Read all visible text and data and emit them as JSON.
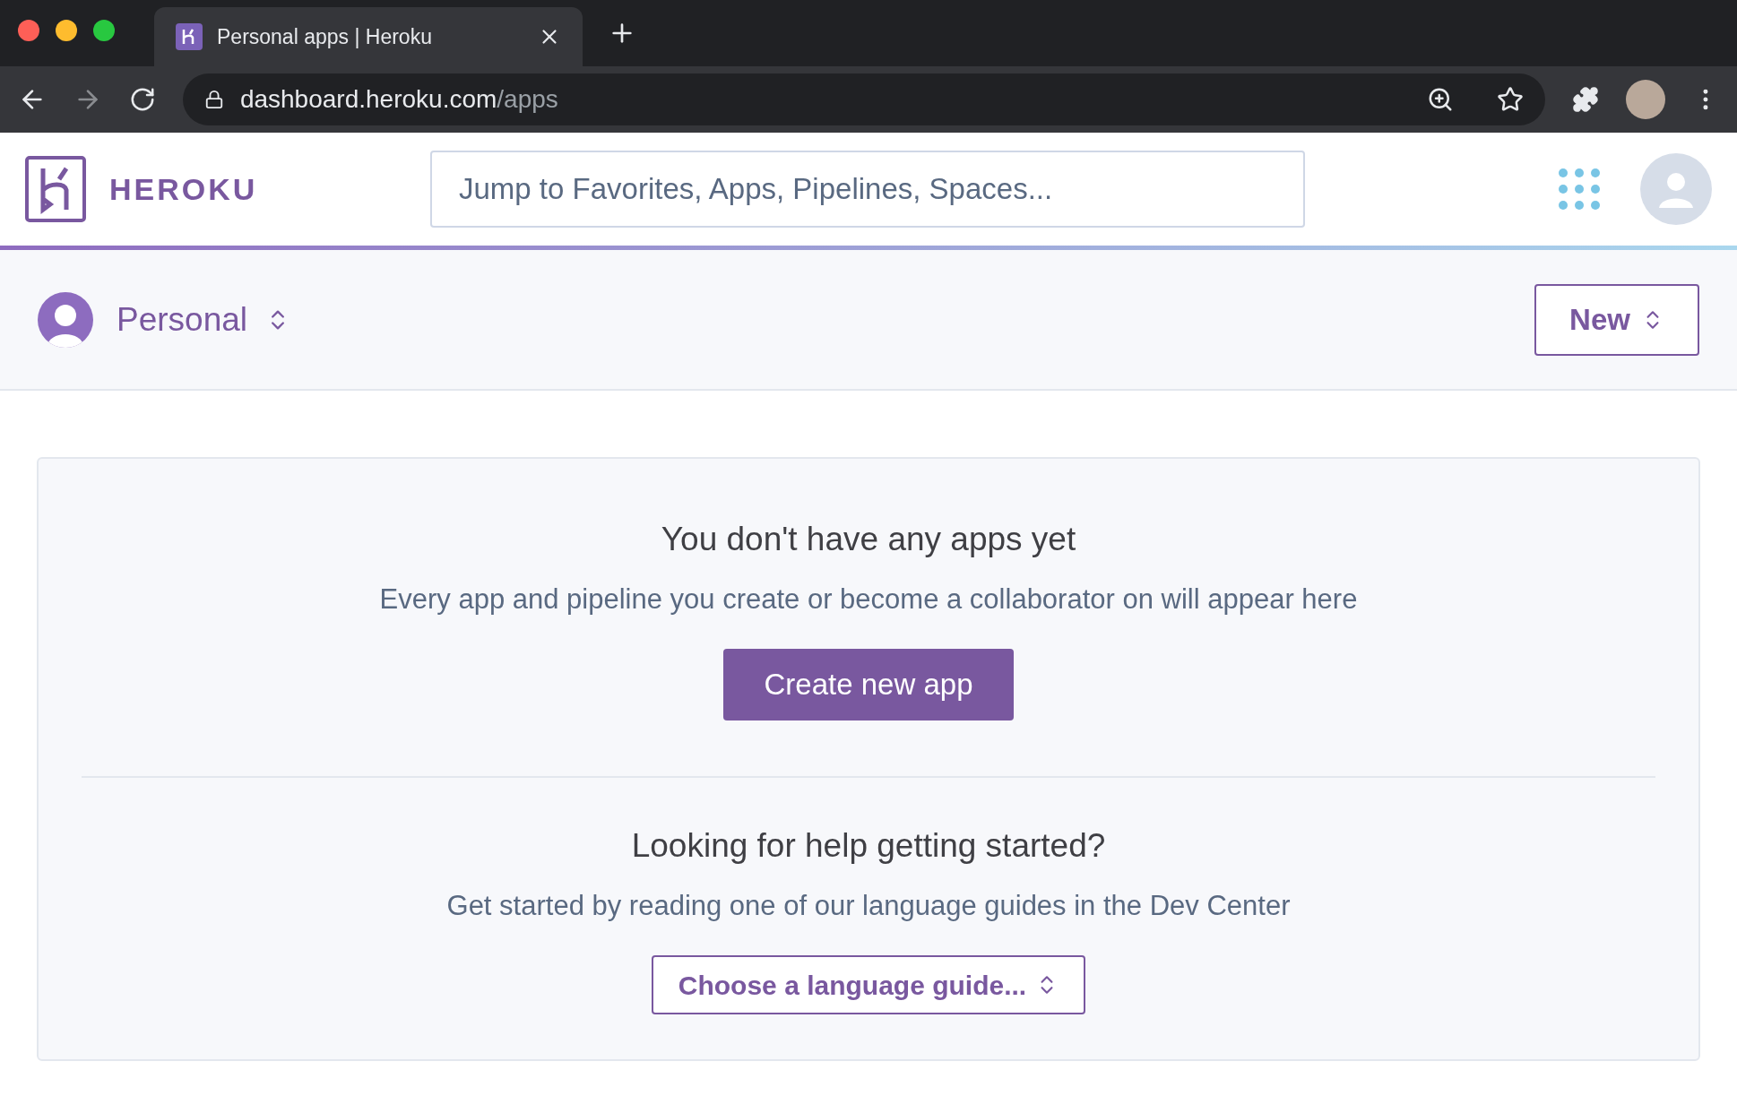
{
  "browser": {
    "tab_title": "Personal apps | Heroku",
    "url_host": "dashboard.heroku.com",
    "url_path": "/apps"
  },
  "header": {
    "logo_text": "HEROKU",
    "search": {
      "placeholder": "Jump to Favorites, Apps, Pipelines, Spaces..."
    }
  },
  "account_bar": {
    "account": "Personal",
    "new_button": "New"
  },
  "empty_state": {
    "title": "You don't have any apps yet",
    "subtitle": "Every app and pipeline you create or become a collaborator on will appear here",
    "button": "Create new app"
  },
  "help": {
    "title": "Looking for help getting started?",
    "subtitle": "Get started by reading one of our language guides in the Dev Center",
    "select": "Choose a language guide..."
  }
}
